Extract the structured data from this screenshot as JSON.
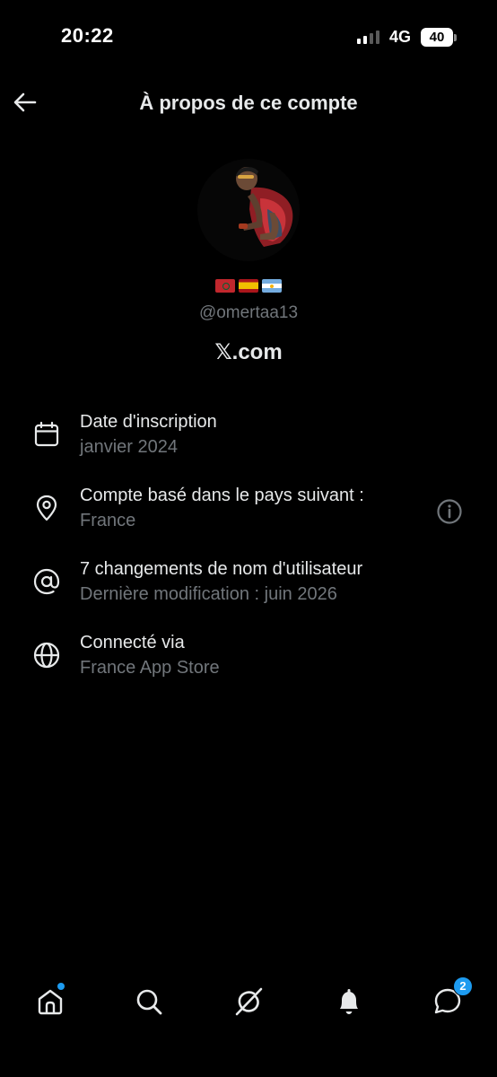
{
  "status_bar": {
    "time": "20:22",
    "network": "4G",
    "battery": "40"
  },
  "header": {
    "title": "À propos de ce compte",
    "back_icon": "arrow-left-icon"
  },
  "profile": {
    "flags": [
      "🇲🇦",
      "🇪🇸",
      "🇦🇷"
    ],
    "handle": "@omertaa13",
    "site": "𝕏.com"
  },
  "info": {
    "items": [
      {
        "icon": "calendar-icon",
        "title": "Date d'inscription",
        "subtitle": "janvier 2024"
      },
      {
        "icon": "location-pin-icon",
        "title": "Compte basé dans le pays suivant :",
        "subtitle": "France",
        "action_icon": "info-icon"
      },
      {
        "icon": "at-sign-icon",
        "title": "7 changements de nom d'utilisateur",
        "subtitle": "Dernière modification : juin 2026"
      },
      {
        "icon": "globe-icon",
        "title": "Connecté via",
        "subtitle": "France App Store"
      }
    ]
  },
  "bottom_nav": {
    "items": [
      {
        "icon": "home-icon",
        "has_dot": true
      },
      {
        "icon": "search-icon"
      },
      {
        "icon": "grok-icon"
      },
      {
        "icon": "notifications-bell-icon"
      },
      {
        "icon": "messages-icon",
        "badge": "2"
      }
    ]
  },
  "colors": {
    "background": "#000000",
    "primary_text": "#e7e9ea",
    "secondary_text": "#71767b",
    "accent": "#1d9bf0"
  }
}
